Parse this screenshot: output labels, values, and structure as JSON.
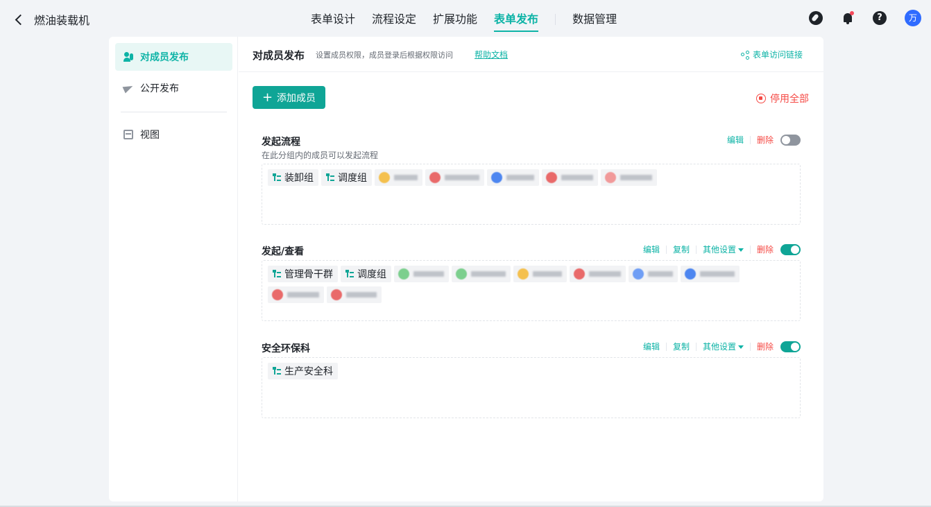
{
  "app": {
    "title": "燃油装载机"
  },
  "nav": {
    "tabs": [
      "表单设计",
      "流程设定",
      "扩展功能",
      "表单发布",
      "数据管理"
    ],
    "active_index": 3
  },
  "user": {
    "avatar_text": "万"
  },
  "sidebar": {
    "items": [
      {
        "label": "对成员发布",
        "icon": "users-icon",
        "active": true
      },
      {
        "label": "公开发布",
        "icon": "paper-plane-icon",
        "active": false
      },
      {
        "label": "视图",
        "icon": "view-icon",
        "active": false
      }
    ]
  },
  "header": {
    "title": "对成员发布",
    "description": "设置成员权限，成员登录后根据权限访问",
    "help_link": "帮助文档",
    "share_link": "表单访问链接"
  },
  "toolbar": {
    "add_member": "添加成员",
    "stop_all": "停用全部"
  },
  "groups": [
    {
      "name": "发起流程",
      "description": "在此分组内的成员可以发起流程",
      "actions": [
        "编辑",
        "删除"
      ],
      "enabled": false,
      "departments": [
        "装卸组",
        "调度组"
      ],
      "members": [
        {
          "avatar_color": "#f4c04e"
        },
        {
          "avatar_color": "#e96a6a"
        },
        {
          "avatar_color": "#4d86f0"
        },
        {
          "avatar_color": "#e96a6a"
        },
        {
          "avatar_color": "#f19a9a"
        }
      ]
    },
    {
      "name": "发起/查看",
      "description": "",
      "actions": [
        "编辑",
        "复制",
        "其他设置",
        "删除"
      ],
      "enabled": true,
      "departments": [
        "管理骨干群",
        "调度组"
      ],
      "members": [
        {
          "avatar_color": "#7ccf8e"
        },
        {
          "avatar_color": "#7ccf8e"
        },
        {
          "avatar_color": "#f4c04e"
        },
        {
          "avatar_color": "#e96a6a"
        },
        {
          "avatar_color": "#6f9ef5"
        },
        {
          "avatar_color": "#4d86f0"
        },
        {
          "avatar_color": "#e96a6a"
        },
        {
          "avatar_color": "#e96a6a"
        }
      ]
    },
    {
      "name": "安全环保科",
      "description": "",
      "actions": [
        "编辑",
        "复制",
        "其他设置",
        "删除"
      ],
      "enabled": true,
      "departments": [
        "生产安全科"
      ],
      "members": []
    }
  ],
  "colors": {
    "accent": "#0db3a6",
    "primary_button": "#0fa596",
    "danger": "#f54a45"
  }
}
